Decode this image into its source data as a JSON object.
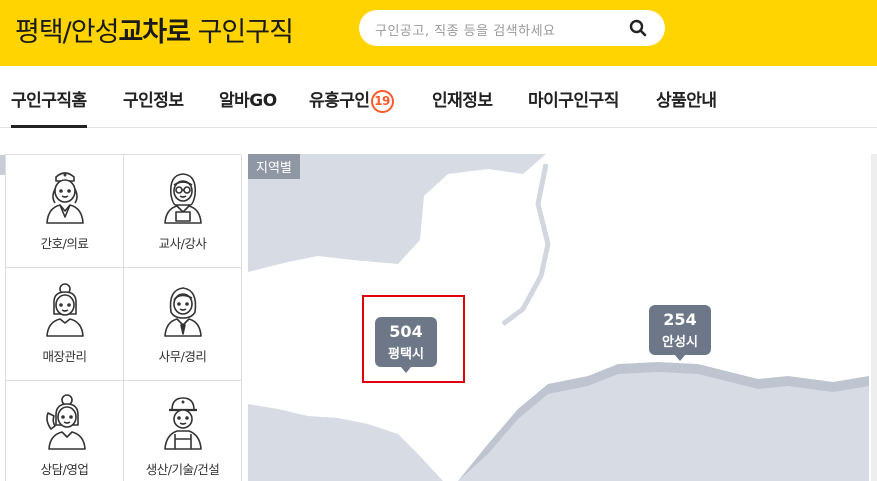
{
  "header": {
    "logo_regular": "평택/안성",
    "logo_bold": "교차로",
    "logo_suffix": "구인구직",
    "search_placeholder": "구인공고, 직종 등을 검색하세요",
    "brand_color": "#ffd400"
  },
  "nav": {
    "items": [
      {
        "label": "구인구직홈",
        "active": true
      },
      {
        "label": "구인정보"
      },
      {
        "label": "알바GO"
      },
      {
        "label": "유흥구인",
        "badge": "19"
      },
      {
        "label": "인재정보"
      },
      {
        "label": "마이구인구직"
      },
      {
        "label": "상품안내"
      }
    ]
  },
  "categories": [
    {
      "label": "간호/의료",
      "icon": "nurse-icon"
    },
    {
      "label": "교사/강사",
      "icon": "teacher-icon"
    },
    {
      "label": "매장관리",
      "icon": "store-manager-icon"
    },
    {
      "label": "사무/경리",
      "icon": "office-worker-icon"
    },
    {
      "label": "상담/영업",
      "icon": "call-agent-icon"
    },
    {
      "label": "생산/기술/건설",
      "icon": "construction-worker-icon"
    }
  ],
  "map": {
    "tag": "지역별",
    "regions": [
      {
        "count": "504",
        "name": "평택시"
      },
      {
        "count": "254",
        "name": "안성시"
      }
    ],
    "highlight_color": "#e1000f"
  }
}
